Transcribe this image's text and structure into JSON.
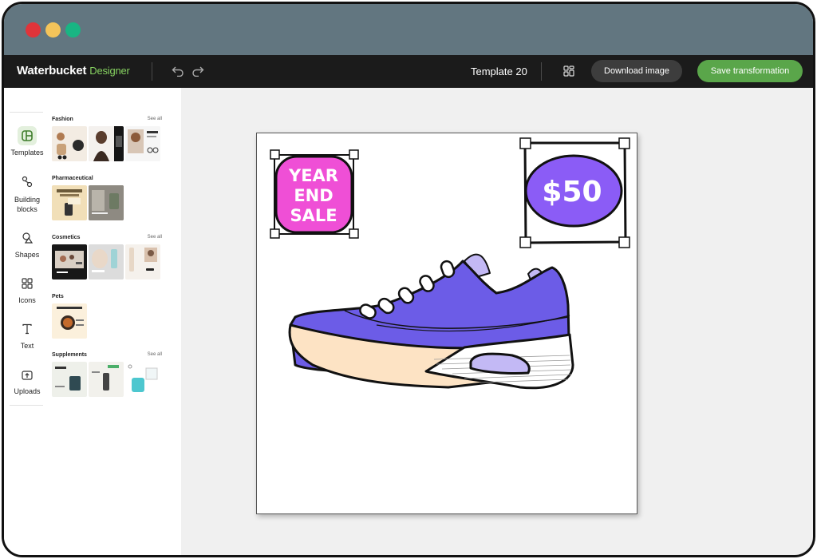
{
  "app": {
    "brand": "Waterbucket",
    "brand_sub": "Designer",
    "template_name": "Template 20",
    "download_label": "Download image",
    "save_label": "Save transformation"
  },
  "tools": [
    {
      "label": "Templates",
      "icon": "templates-icon",
      "active": true
    },
    {
      "label": "Building blocks",
      "icon": "building-blocks-icon"
    },
    {
      "label": "Shapes",
      "icon": "shapes-icon"
    },
    {
      "label": "Icons",
      "icon": "icons-grid-icon"
    },
    {
      "label": "Text",
      "icon": "text-icon"
    },
    {
      "label": "Uploads",
      "icon": "upload-icon"
    }
  ],
  "categories": [
    {
      "title": "Fashion",
      "see_all": "See all"
    },
    {
      "title": "Pharmaceutical",
      "see_all": ""
    },
    {
      "title": "Cosmetics",
      "see_all": "See all"
    },
    {
      "title": "Pets",
      "see_all": ""
    },
    {
      "title": "Supplements",
      "see_all": "See all"
    }
  ],
  "canvas": {
    "sale_text_1": "YEAR",
    "sale_text_2": "END",
    "sale_text_3": "SALE",
    "price_text": "$50",
    "colors": {
      "sale_bg": "#ef4fd6",
      "price_bg": "#8b5cf6",
      "shoe": "#6c5ce7",
      "sole": "#fde3c4"
    }
  },
  "colors": {
    "titlebar": "#627680",
    "appbar": "#1b1b1b",
    "accent": "#86d160",
    "save": "#5aa64a"
  }
}
